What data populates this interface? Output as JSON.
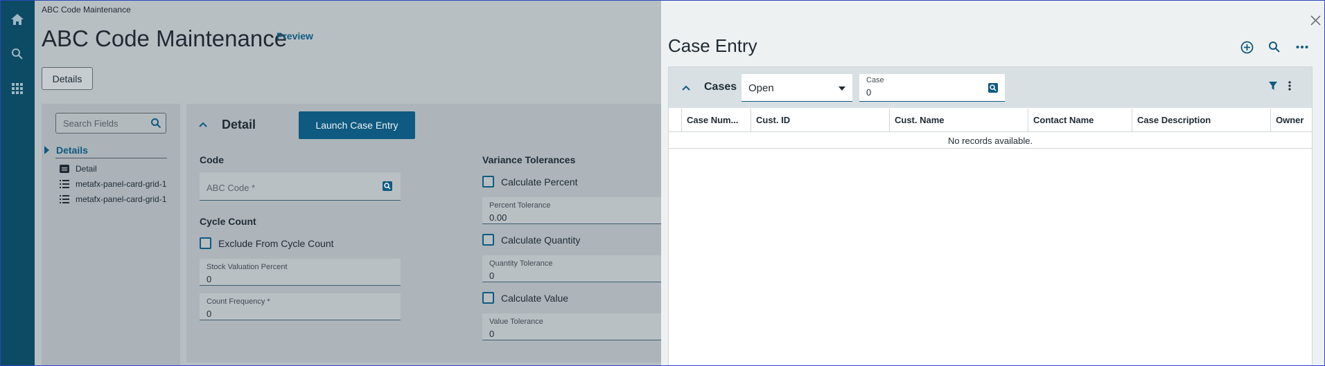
{
  "app": {
    "breadcrumb": "ABC Code Maintenance",
    "title": "ABC Code Maintenance",
    "preview_label": "Preview",
    "details_button": "Details"
  },
  "left_panel": {
    "search_placeholder": "Search Fields",
    "tree_header": "Details",
    "items": [
      {
        "label": "Detail",
        "icon": "detail-card-icon"
      },
      {
        "label": "metafx-panel-card-grid-1",
        "icon": "list-icon"
      },
      {
        "label": "metafx-panel-card-grid-1",
        "icon": "list-icon"
      }
    ]
  },
  "detail_card": {
    "title": "Detail",
    "launch_button": "Launch Case Entry",
    "code_section": "Code",
    "abc_code_placeholder": "ABC Code *",
    "cycle_count_section": "Cycle Count",
    "exclude_checkbox": "Exclude From Cycle Count",
    "stock_valuation_label": "Stock Valuation Percent",
    "stock_valuation_value": "0",
    "count_frequency_label": "Count Frequency *",
    "count_frequency_value": "0",
    "variance_section": "Variance Tolerances",
    "calc_percent": "Calculate Percent",
    "percent_tolerance_label": "Percent Tolerance",
    "percent_tolerance_value": "0.00",
    "calc_quantity": "Calculate Quantity",
    "quantity_tolerance_label": "Quantity Tolerance",
    "quantity_tolerance_value": "0",
    "calc_value": "Calculate Value",
    "value_tolerance_label": "Value Tolerance",
    "value_tolerance_value": "0"
  },
  "case_entry": {
    "title": "Case Entry",
    "grid_title": "Cases",
    "status_value": "Open",
    "case_label": "Case",
    "case_value": "0",
    "columns": [
      "Case Num...",
      "Cust. ID",
      "Cust. Name",
      "Contact Name",
      "Case Description",
      "Owner"
    ],
    "empty_message": "No records available."
  },
  "colors": {
    "rail": "#0d4a63",
    "accent": "#0f5a80",
    "panel_bg": "#eef1f2"
  }
}
